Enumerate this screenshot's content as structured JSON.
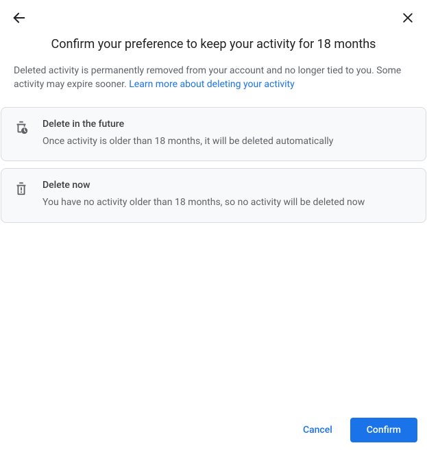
{
  "header": {
    "title": "Confirm your preference to keep your activity for 18 months"
  },
  "description": {
    "text": "Deleted activity is permanently removed from your account and no longer tied to you. Some activity may expire sooner. ",
    "link_text": "Learn more about deleting your activity"
  },
  "cards": [
    {
      "title": "Delete in the future",
      "subtitle": "Once activity is older than 18 months, it will be deleted automatically"
    },
    {
      "title": "Delete now",
      "subtitle": "You have no activity older than 18 months, so no activity will be deleted now"
    }
  ],
  "footer": {
    "cancel_label": "Cancel",
    "confirm_label": "Confirm"
  }
}
